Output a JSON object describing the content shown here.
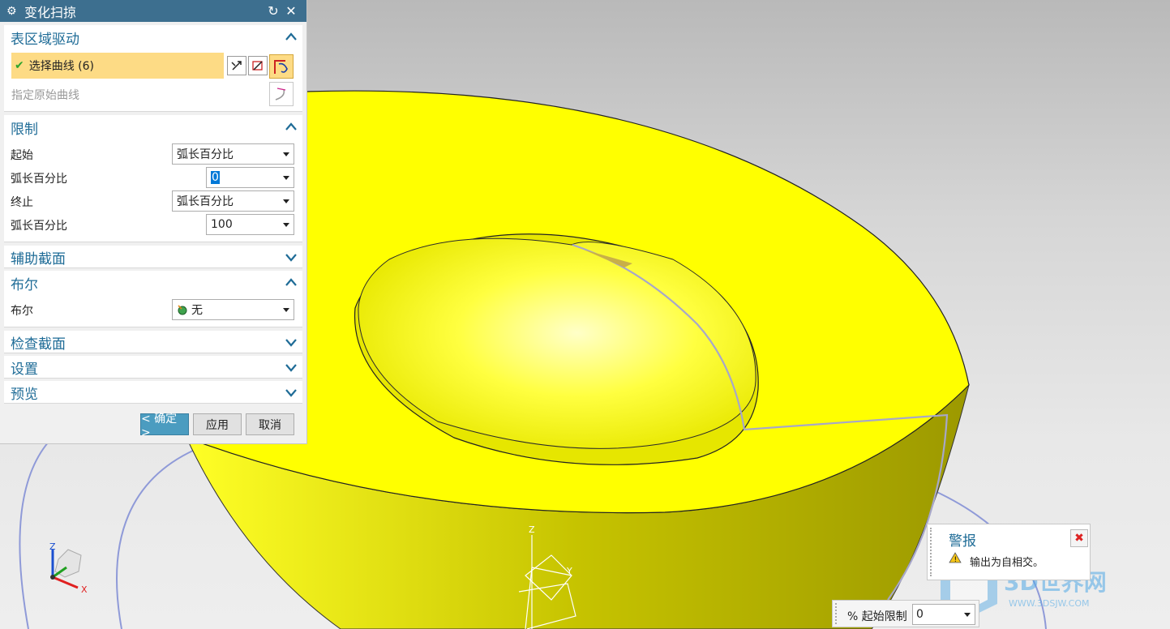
{
  "dialog": {
    "title": "变化扫掠",
    "reset_icon": "reset-icon",
    "close_icon": "close-icon",
    "sections": {
      "surface_drive": {
        "title": "表区域驱动",
        "select_curve": "选择曲线 (6)",
        "specify_original": "指定原始曲线"
      },
      "limits": {
        "title": "限制",
        "start_label": "起始",
        "start_value": "弧长百分比",
        "start_pct_label": "弧长百分比",
        "start_pct_value": "0",
        "end_label": "终止",
        "end_value": "弧长百分比",
        "end_pct_label": "弧长百分比",
        "end_pct_value": "100"
      },
      "aux_section": {
        "title": "辅助截面"
      },
      "boolean": {
        "title": "布尔",
        "label": "布尔",
        "value": "无"
      },
      "check_section": {
        "title": "检查截面"
      },
      "settings": {
        "title": "设置"
      },
      "preview": {
        "title": "预览"
      }
    },
    "ok": "< 确定 >",
    "apply": "应用",
    "cancel": "取消"
  },
  "alert": {
    "title": "警报",
    "message": "输出为自相交。"
  },
  "status_bar": {
    "label": "% 起始限制",
    "value": "0"
  },
  "axes": {
    "x": "X",
    "y": "Y",
    "z": "Z"
  },
  "watermark": {
    "title": "3D世界网",
    "url": "WWW.3DSJW.COM"
  },
  "colors": {
    "accent": "#3d6f8f",
    "section_title": "#1f6c97",
    "selected_row": "#fddb85",
    "model": "#ffff00",
    "ok_button": "#4b9cc0"
  }
}
